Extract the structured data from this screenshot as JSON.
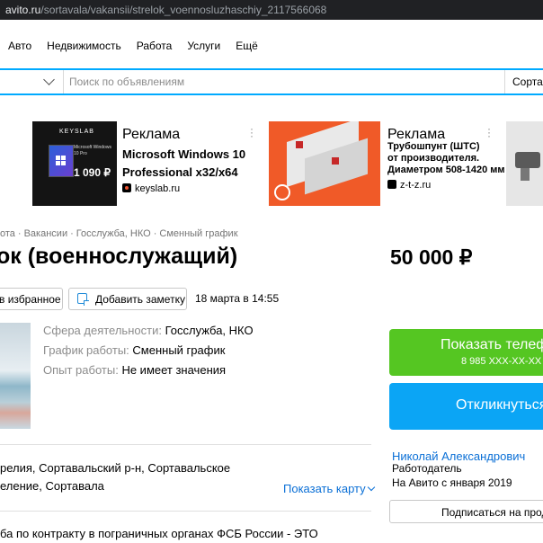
{
  "browser": {
    "url_prefix": "avito.ru",
    "url_path": "/sortavala/vakansii/strelok_voennosluzhaschiy_2117566068"
  },
  "nav": {
    "items": [
      "Авто",
      "Недвижимость",
      "Работа",
      "Услуги",
      "Ещё"
    ]
  },
  "search": {
    "placeholder": "Поиск по объявлениям",
    "city": "Сортав"
  },
  "ads": [
    {
      "label": "Реклама",
      "title": "Microsoft Windows 10 Professional x32/x64",
      "title_l1": "Microsoft Windows 10",
      "title_l2": "Professional x32/x64",
      "domain": "keyslab.ru",
      "img_brand": "KEYSLAB",
      "img_product": "Microsoft Windows 10 Pro",
      "img_price": "1 090 ₽"
    },
    {
      "label": "Реклама",
      "title_l1": "Трубошпунт (ШТС)",
      "title_l2": "от производителя.",
      "title_l3": "Диаметром 508-1420 мм",
      "domain": "z-t-z.ru"
    }
  ],
  "breadcrumbs": [
    "ота",
    "Вакансии",
    "Госслужба, НКО",
    "Сменный график"
  ],
  "listing": {
    "title": "ок (военнослужащий)",
    "price": "50 000 ₽",
    "favorite_label": "в избранное",
    "note_label": "Добавить заметку",
    "date": "18 марта в 14:55",
    "params": [
      {
        "key": "Сфера деятельности:",
        "value": "Госслужба, НКО"
      },
      {
        "key": "График работы:",
        "value": "Сменный график"
      },
      {
        "key": "Опыт работы:",
        "value": "Не имеет значения"
      }
    ],
    "address_l1": "релия, Сортавальский р-н, Сортавальское",
    "address_l2": "еление, Сортавала",
    "show_map": "Показать карту",
    "description": "ба по контракту в пограничных органах ФСБ России - ЭТО"
  },
  "contact": {
    "phone_label": "Показать телеф",
    "phone_masked": "8 985 XXX-XX-XX",
    "reply_label": "Откликнуться",
    "seller_name": "Николай Александрович",
    "seller_role": "Работодатель",
    "seller_since": "На Авито с января 2019",
    "subscribe_label": "Подписаться на прода"
  },
  "colors": {
    "accent_blue": "#00aaff",
    "phone_green": "#55c622",
    "reply_blue": "#0ba5f5",
    "link": "#0a6fd6"
  }
}
